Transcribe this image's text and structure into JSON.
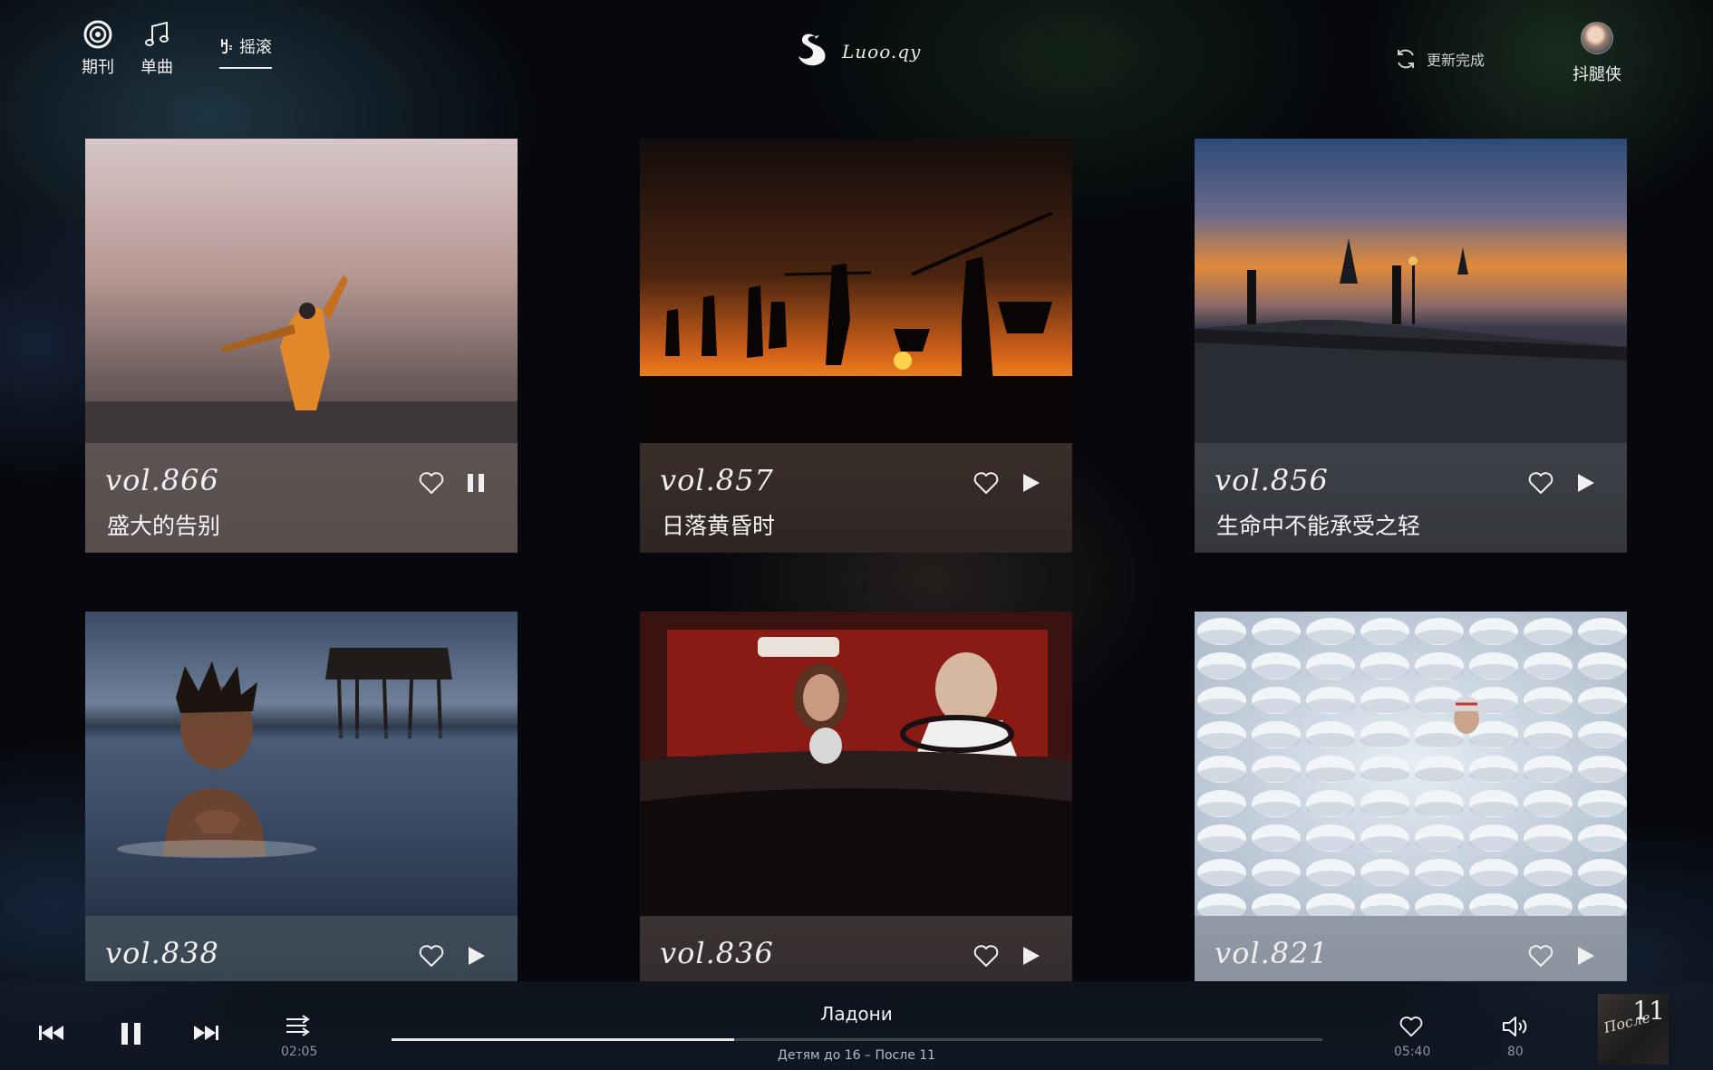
{
  "nav": {
    "items": [
      {
        "label": "期刊",
        "icon": "disc-icon"
      },
      {
        "label": "单曲",
        "icon": "music-note-icon"
      }
    ],
    "active_tab": {
      "label": "摇滚",
      "icon": "rock-hand-icon"
    }
  },
  "brand": {
    "name": "Luoo.qy",
    "icon": "swan-logo-icon"
  },
  "refresh": {
    "label": "更新完成",
    "icon": "refresh-icon"
  },
  "user": {
    "name": "抖腿侠",
    "icon": "avatar"
  },
  "cards": [
    {
      "vol": "vol.866",
      "title": "盛大的告别",
      "state": "playing",
      "icons": [
        "heart-icon",
        "pause-icon"
      ]
    },
    {
      "vol": "vol.857",
      "title": "日落黄昏时",
      "state": "paused",
      "icons": [
        "heart-icon",
        "play-icon"
      ]
    },
    {
      "vol": "vol.856",
      "title": "生命中不能承受之轻",
      "state": "paused",
      "icons": [
        "heart-icon",
        "play-icon"
      ]
    },
    {
      "vol": "vol.838",
      "title": "",
      "state": "paused",
      "icons": [
        "heart-icon",
        "play-icon"
      ]
    },
    {
      "vol": "vol.836",
      "title": "",
      "state": "paused",
      "icons": [
        "heart-icon",
        "play-icon"
      ]
    },
    {
      "vol": "vol.821",
      "title": "",
      "state": "paused",
      "icons": [
        "heart-icon",
        "play-icon"
      ]
    }
  ],
  "player": {
    "track_title": "Ладони",
    "track_artist": "Детям до 16 – После 11",
    "elapsed": "02:05",
    "duration": "05:40",
    "volume": "80",
    "progress_fraction": 0.368,
    "cover_text": "После",
    "cover_number": "11",
    "icons": [
      "previous-icon",
      "pause-icon",
      "next-icon",
      "shuffle-icon",
      "heart-icon",
      "volume-icon"
    ]
  },
  "colors": {
    "background": "#06080d",
    "text": "#f2f2f2",
    "muted": "#8a95a3"
  }
}
